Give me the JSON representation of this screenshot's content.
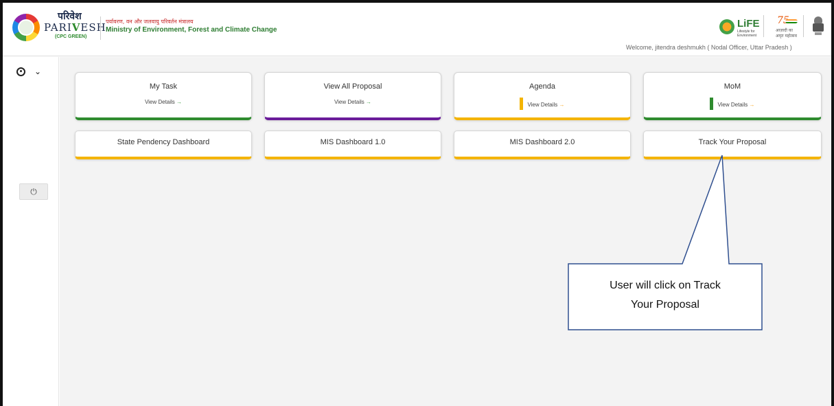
{
  "header": {
    "brand_hindi": "परिवेश",
    "brand_name_pre": "PARI",
    "brand_name_v": "V",
    "brand_name_post": "ESH",
    "brand_sub": "(CPC GREEN)",
    "ministry_hindi": "पर्यावरण, वन और जलवायु परिवर्तन मंत्रालय",
    "ministry_english": "Ministry of Environment, Forest and Climate Change",
    "life_logo": "LiFE",
    "life_sub": "Lifestyle for Environment",
    "azadi_number": "75",
    "azadi_text": "आज़ादी का अमृत महोत्सव",
    "welcome": "Welcome, jitendra deshmukh ( Nodal Officer, Uttar Pradesh )"
  },
  "sidebar": {
    "user_icon": "user-circle-icon",
    "chevron": "⌄",
    "power_icon": "⏻"
  },
  "cards": [
    {
      "title": "My Task",
      "details": "View Details",
      "arrow": "→"
    },
    {
      "title": "View All Proposal",
      "details": "View Details",
      "arrow": "→"
    },
    {
      "title": "Agenda",
      "details": "View Details",
      "arrow": "→"
    },
    {
      "title": "MoM",
      "details": "View Details",
      "arrow": "→"
    }
  ],
  "dashboards": [
    {
      "label": "State Pendency Dashboard"
    },
    {
      "label": "MIS Dashboard 1.0"
    },
    {
      "label": "MIS Dashboard 2.0"
    },
    {
      "label": "Track Your Proposal"
    }
  ],
  "callout": {
    "text_line1": "User will click on Track",
    "text_line2": "Your Proposal"
  },
  "colors": {
    "green": "#2e8b2e",
    "purple": "#6a1b9a",
    "yellow": "#f4b400",
    "callout_border": "#2f4f8f"
  }
}
